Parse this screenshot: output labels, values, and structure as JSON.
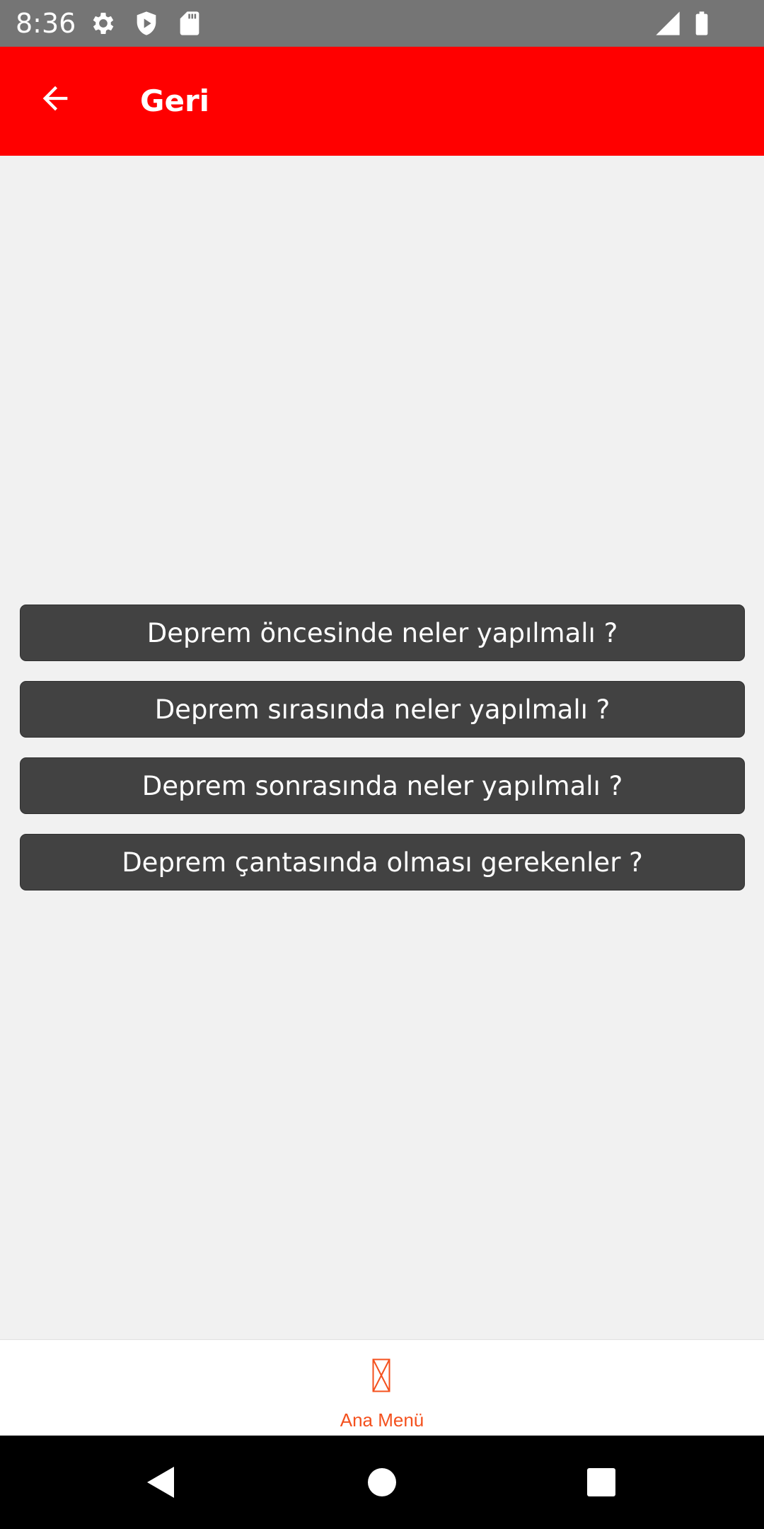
{
  "status_bar": {
    "time": "8:36",
    "icons": [
      "gear-icon",
      "shield-play-icon",
      "sd-card-icon",
      "signal-icon",
      "battery-icon"
    ]
  },
  "app_bar": {
    "title": "Geri",
    "back_icon": "arrow-left-icon",
    "background_color": "#ff0000"
  },
  "menu": {
    "buttons": [
      {
        "label": "Deprem öncesinde neler yapılmalı ?"
      },
      {
        "label": "Deprem sırasında neler yapılmalı ?"
      },
      {
        "label": "Deprem sonrasında neler yapılmalı ?"
      },
      {
        "label": "Deprem çantasında olması gerekenler ?"
      }
    ],
    "button_color": "#424242"
  },
  "bottom_tab": {
    "label": "Ana Menü",
    "icon": "missing-glyph-icon",
    "color": "#f4511e"
  },
  "nav_bar": {
    "buttons": [
      "back-triangle-icon",
      "home-circle-icon",
      "recents-square-icon"
    ]
  }
}
